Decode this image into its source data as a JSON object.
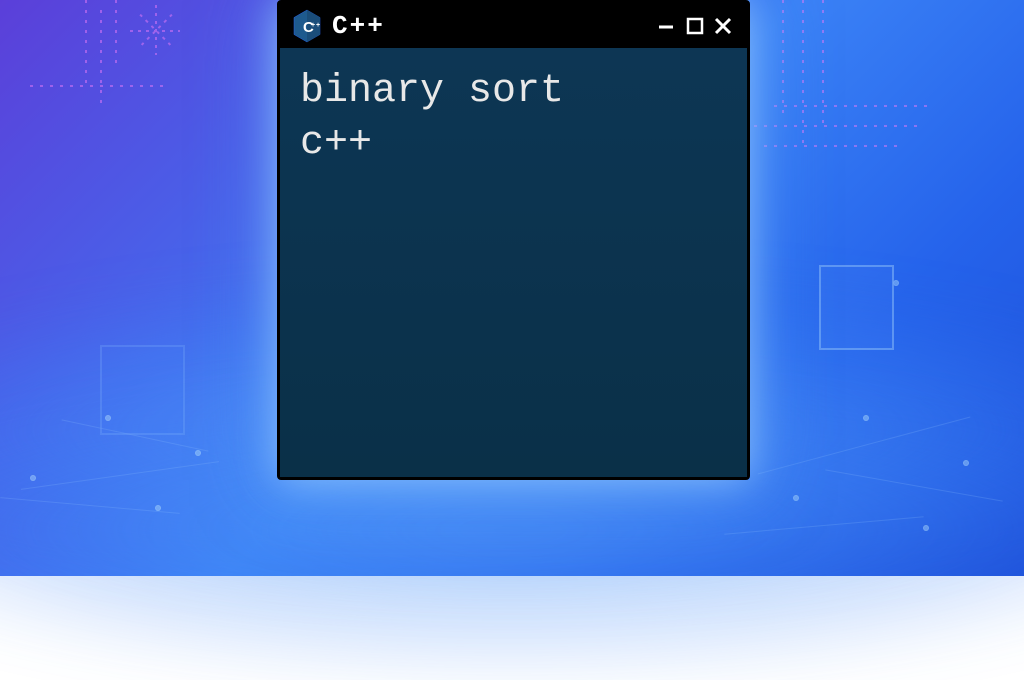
{
  "window": {
    "title": "C++",
    "logo_name": "cpp-logo"
  },
  "terminal": {
    "content": "binary sort\nc++"
  },
  "colors": {
    "terminal_bg": "#0a3a5c",
    "title_bg": "#000000",
    "text": "#e8e8e8",
    "glow": "#60a5fa"
  }
}
